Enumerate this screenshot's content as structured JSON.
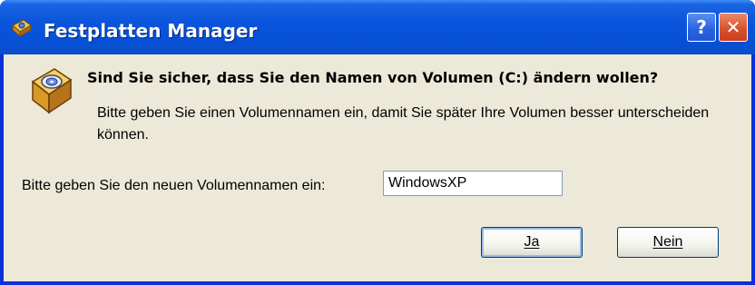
{
  "window": {
    "title": "Festplatten Manager",
    "title_icon": "disk-manager-icon",
    "help_label": "?",
    "close_label": "✕"
  },
  "dialog": {
    "icon": "disk-rename-icon",
    "question": "Sind Sie sicher, dass Sie den Namen von Volumen (C:) ändern wollen?",
    "info": "Bitte geben Sie einen Volumennamen ein, damit Sie später Ihre Volumen besser unterscheiden können.",
    "field_label": "Bitte geben Sie den neuen Volumennamen ein:",
    "field_value": "WindowsXP",
    "yes_label": "Ja",
    "no_label": "Nein"
  },
  "colors": {
    "titlebar": "#0a55dc",
    "client_bg": "#ece9d8",
    "close_red": "#d9532a",
    "icon_gold": "#e8b53c"
  }
}
